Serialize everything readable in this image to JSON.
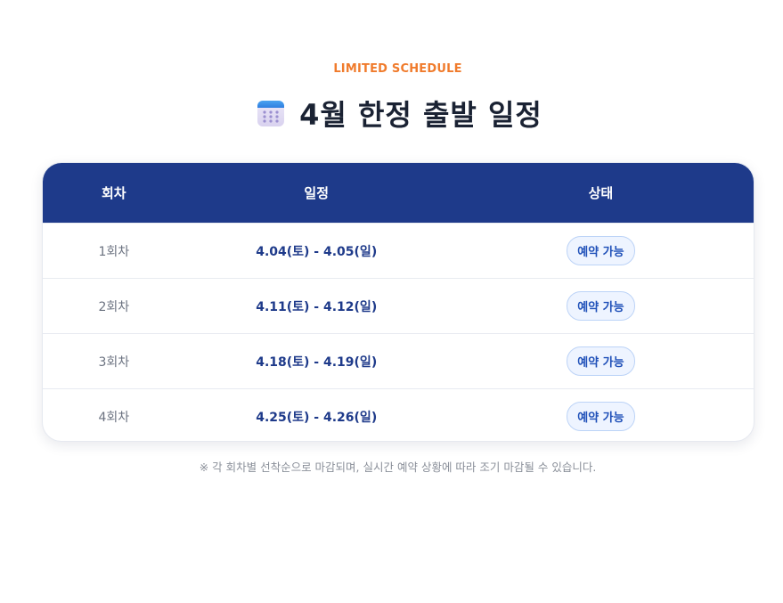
{
  "header": {
    "eyebrow": "LIMITED SCHEDULE",
    "title": "4월 한정 출발 일정",
    "icon": "calendar-icon"
  },
  "table": {
    "columns": [
      "회차",
      "일정",
      "상태"
    ],
    "rows": [
      {
        "round": "1회차",
        "dates": "4.04(토) - 4.05(일)",
        "status": "예약 가능"
      },
      {
        "round": "2회차",
        "dates": "4.11(토) - 4.12(일)",
        "status": "예약 가능"
      },
      {
        "round": "3회차",
        "dates": "4.18(토) - 4.19(일)",
        "status": "예약 가능"
      },
      {
        "round": "4회차",
        "dates": "4.25(토) - 4.26(일)",
        "status": "예약 가능"
      }
    ]
  },
  "footnote": "※ 각 회차별 선착순으로 마감되며, 실시간 예약 상황에 따라 조기 마감될 수 있습니다.",
  "colors": {
    "accent": "#f07b2c",
    "header_bg": "#1e3a8a",
    "badge_bg": "#eef4ff",
    "badge_text": "#1e4fb8"
  }
}
